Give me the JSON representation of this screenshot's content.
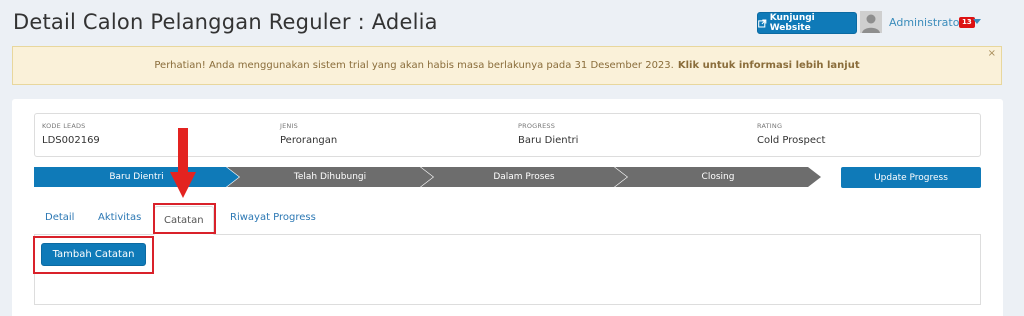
{
  "header": {
    "title": "Detail Calon Pelanggan Reguler : Adelia",
    "visit_button": "Kunjungi Website",
    "user": {
      "name": "Administrator",
      "badge": "13"
    }
  },
  "alert": {
    "text": "Perhatian! Anda menggunakan sistem trial yang akan habis masa berlakunya pada 31 Desember 2023.",
    "link": "Klik untuk informasi lebih lanjut",
    "close": "×"
  },
  "lead_info": [
    {
      "label": "KODE LEADS",
      "value": "LDS002169"
    },
    {
      "label": "JENIS",
      "value": "Perorangan"
    },
    {
      "label": "PROGRESS",
      "value": "Baru Dientri"
    },
    {
      "label": "RATING",
      "value": "Cold Prospect"
    }
  ],
  "progress_steps": [
    "Baru Dientri",
    "Telah Dihubungi",
    "Dalam Proses",
    "Closing"
  ],
  "update_button": "Update Progress",
  "tabs": [
    "Detail",
    "Aktivitas",
    "Catatan",
    "Riwayat Progress"
  ],
  "active_tab": "Catatan",
  "add_note_button": "Tambah Catatan",
  "colors": {
    "primary": "#0f7ab8",
    "step_inactive": "#6d6d6d",
    "highlight": "#d9212a",
    "alert_bg": "#faf1d9"
  },
  "icons": [
    "external-link-icon",
    "user-avatar-icon",
    "caret-down-icon",
    "close-icon",
    "arrow-down-icon"
  ]
}
